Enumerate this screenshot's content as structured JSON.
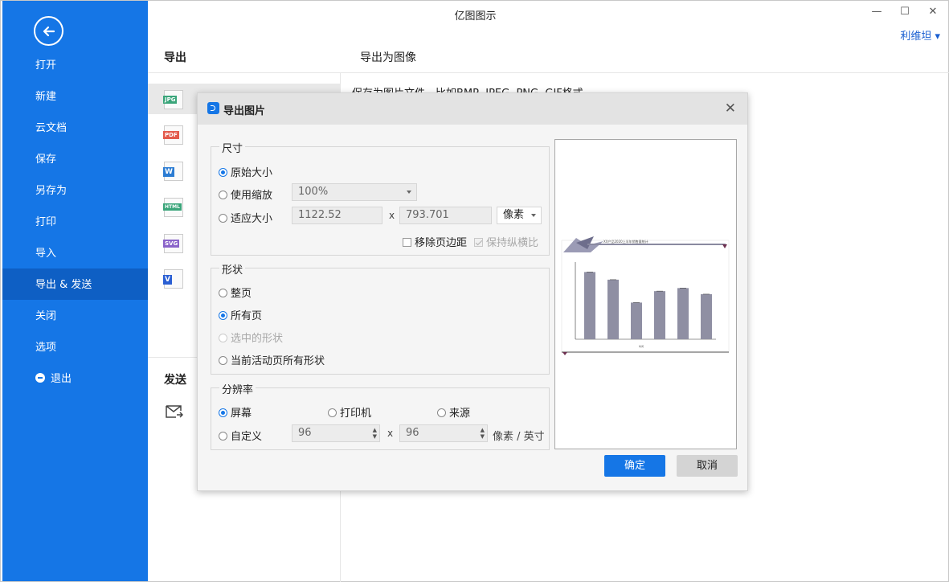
{
  "window": {
    "title": "亿图图示",
    "user": "利维坦 ▾"
  },
  "sidebar": {
    "items": [
      {
        "label": "打开"
      },
      {
        "label": "新建"
      },
      {
        "label": "云文档"
      },
      {
        "label": "保存"
      },
      {
        "label": "另存为"
      },
      {
        "label": "打印"
      },
      {
        "label": "导入"
      },
      {
        "label": "导出 & 发送",
        "active": true
      },
      {
        "label": "关闭"
      },
      {
        "label": "选项"
      },
      {
        "label": "退出"
      }
    ]
  },
  "middle": {
    "export_header": "导出",
    "send_header": "发送",
    "formats": [
      {
        "tag": "JPG",
        "color": "#3aa57a"
      },
      {
        "tag": "PDF",
        "color": "#e35a4c"
      },
      {
        "tag": "W",
        "color": "#2b7cd3"
      },
      {
        "tag": "HTML",
        "color": "#3aa57a"
      },
      {
        "tag": "SVG",
        "color": "#8a63c9"
      },
      {
        "tag": "V",
        "color": "#2b5fd3"
      }
    ]
  },
  "right": {
    "header": "导出为图像",
    "description": "保存为图片文件，比如BMP, JPEG, PNG, GIF格式。"
  },
  "dialog": {
    "title": "导出图片",
    "size": {
      "label": "尺寸",
      "original": "原始大小",
      "use_zoom": "使用缩放",
      "zoom_value": "100%",
      "fit": "适应大小",
      "width": "1122.52",
      "x": "x",
      "height": "793.701",
      "unit": "像素",
      "remove_margin": "移除页边距",
      "keep_ratio": "保持纵横比"
    },
    "shape": {
      "label": "形状",
      "whole_page": "整页",
      "all_pages": "所有页",
      "selected": "选中的形状",
      "active_page": "当前活动页所有形状"
    },
    "resolution": {
      "label": "分辨率",
      "screen": "屏幕",
      "printer": "打印机",
      "source": "来源",
      "custom": "自定义",
      "dpi_x": "96",
      "x": "x",
      "dpi_y": "96",
      "unit": "像素 / 英寸"
    },
    "preview": {
      "chart_title": "XX产品2020上半年销售量统计",
      "chart_xlabel": "时间",
      "bar_values": [
        0.88,
        0.78,
        0.48,
        0.63,
        0.67,
        0.59
      ]
    },
    "ok": "确定",
    "cancel": "取消"
  }
}
